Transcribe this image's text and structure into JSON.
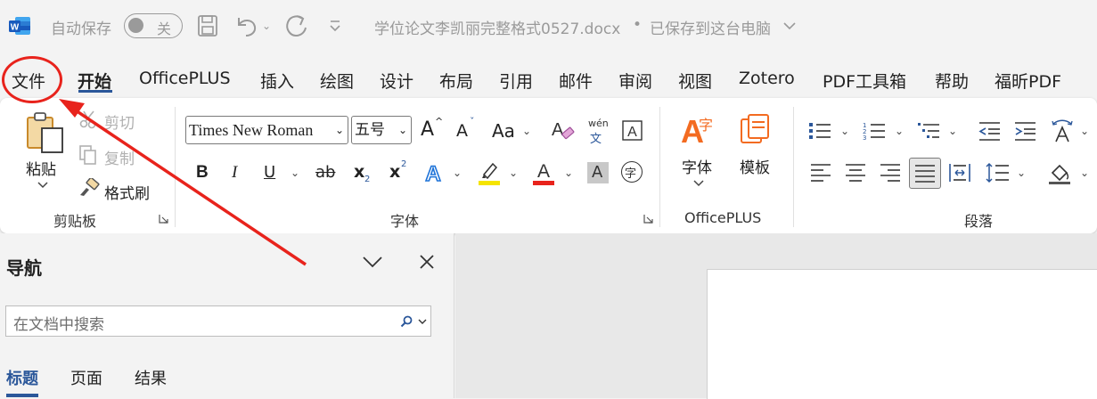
{
  "titlebar": {
    "autosave_label": "自动保存",
    "autosave_state": "关",
    "doc_title": "学位论文李凯丽完整格式0527.docx",
    "separator": "•",
    "save_status": "已保存到这台电脑"
  },
  "tabs": [
    "文件",
    "开始",
    "OfficePLUS",
    "插入",
    "绘图",
    "设计",
    "布局",
    "引用",
    "邮件",
    "审阅",
    "视图",
    "Zotero",
    "PDF工具箱",
    "帮助",
    "福昕PDF"
  ],
  "ribbon": {
    "clipboard": {
      "paste": "粘贴",
      "cut": "剪切",
      "copy": "复制",
      "format_painter": "格式刷",
      "group_label": "剪贴板"
    },
    "font": {
      "font_name": "Times New Roman",
      "font_size": "五号",
      "grow": "A",
      "shrink": "A",
      "change_case": "Aa",
      "phonetic_top": "wén",
      "phonetic_bottom": "文",
      "bold": "B",
      "italic": "I",
      "underline": "U",
      "strike": "ab",
      "subscript": "x",
      "subscript_mark": "2",
      "superscript": "x",
      "superscript_mark": "2",
      "char_shading": "A",
      "enclose": "字",
      "highlight_color": "#f5e400",
      "font_color": "#e8231c",
      "group_label": "字体"
    },
    "officeplus": {
      "font_btn": "字体",
      "template_btn": "模板",
      "group_label": "OfficePLUS"
    },
    "paragraph": {
      "group_label": "段落"
    }
  },
  "navpane": {
    "title": "导航",
    "search_placeholder": "在文档中搜索",
    "tabs": [
      "标题",
      "页面",
      "结果"
    ]
  },
  "colors": {
    "accent": "#2b579a",
    "annotation": "#e8231c"
  }
}
